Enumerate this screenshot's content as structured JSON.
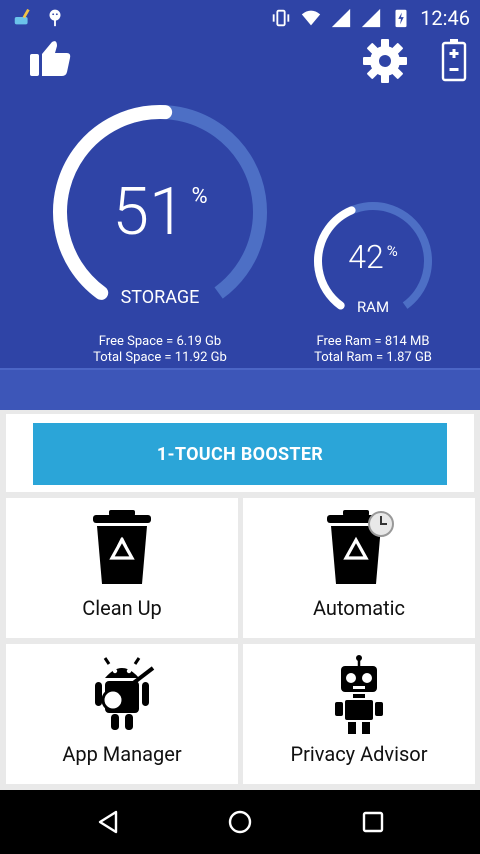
{
  "status": {
    "time": "12:46"
  },
  "storage": {
    "percent": "51",
    "percent_sign": "%",
    "label": "STORAGE",
    "free_line": "Free Space = 6.19 Gb",
    "total_line": "Total Space = 11.92 Gb",
    "fill_fraction": 0.51
  },
  "ram": {
    "percent": "42",
    "percent_sign": "%",
    "label": "RAM",
    "free_line": "Free Ram = 814 MB",
    "total_line": "Total Ram = 1.87 GB",
    "fill_fraction": 0.42
  },
  "booster": {
    "label": "1-TOUCH BOOSTER"
  },
  "tiles": [
    {
      "label": "Clean Up",
      "icon": "trash-recycle-icon"
    },
    {
      "label": "Automatic",
      "icon": "trash-clock-icon"
    },
    {
      "label": "App Manager",
      "icon": "android-guitar-icon"
    },
    {
      "label": "Privacy Advisor",
      "icon": "robot-icon"
    }
  ],
  "colors": {
    "header_bg": "#2f44a6",
    "ring_bg": "#4d6fc5",
    "ring_fg": "#ffffff",
    "booster_bg": "#2ba5d8"
  }
}
